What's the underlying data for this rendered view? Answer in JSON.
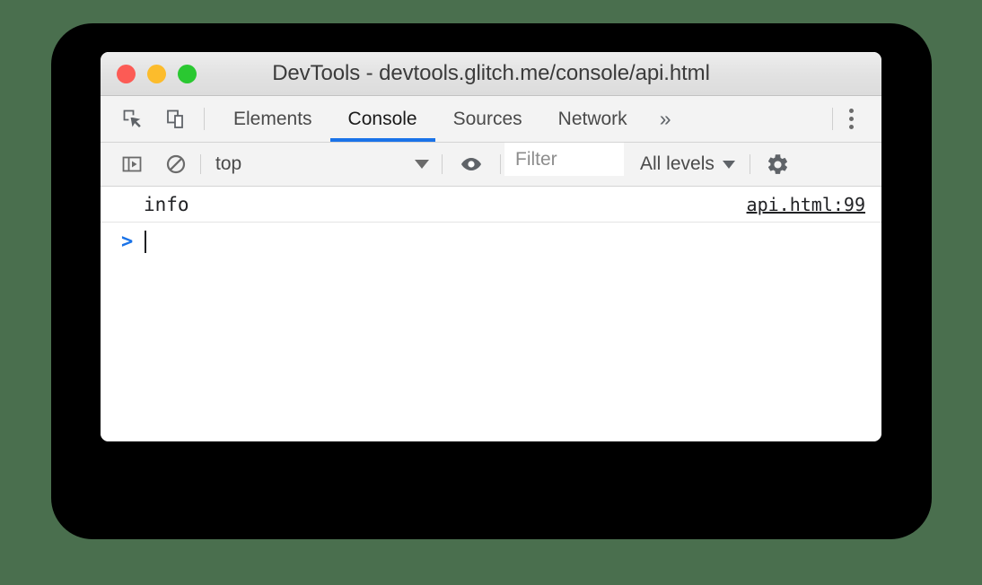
{
  "window": {
    "title": "DevTools - devtools.glitch.me/console/api.html",
    "traffic_lights": [
      {
        "name": "close",
        "color": "#fc5b55"
      },
      {
        "name": "minimize",
        "color": "#fcbc2c"
      },
      {
        "name": "maximize",
        "color": "#2ac831"
      }
    ]
  },
  "tabbar": {
    "tools": [
      {
        "icon": "inspect-element-icon"
      },
      {
        "icon": "device-toolbar-icon"
      }
    ],
    "tabs": [
      {
        "label": "Elements",
        "active": false
      },
      {
        "label": "Console",
        "active": true
      },
      {
        "label": "Sources",
        "active": false
      },
      {
        "label": "Network",
        "active": false
      }
    ],
    "more_tabs_label": "»",
    "menu_icon": "kebab-menu-icon",
    "active_underline_color": "#1a73e8"
  },
  "console_toolbar": {
    "sidebar_toggle_icon": "console-sidebar-icon",
    "clear_console_icon": "clear-console-icon",
    "context": {
      "value": "top",
      "caret": "▼"
    },
    "live_expression_icon": "eye-icon",
    "filter": {
      "value": "",
      "placeholder": "Filter"
    },
    "levels": {
      "value": "All levels",
      "caret": "▼"
    },
    "settings_icon": "gear-icon"
  },
  "console_body": {
    "messages": [
      {
        "text": "info",
        "source": "api.html:99"
      }
    ],
    "prompt": {
      "arrow": ">",
      "input_value": ""
    }
  },
  "colors": {
    "page_background": "#4a6f4e",
    "backdrop": "#000000",
    "window_background": "#ffffff",
    "toolbar_background": "#f3f3f3",
    "accent": "#1a73e8"
  }
}
